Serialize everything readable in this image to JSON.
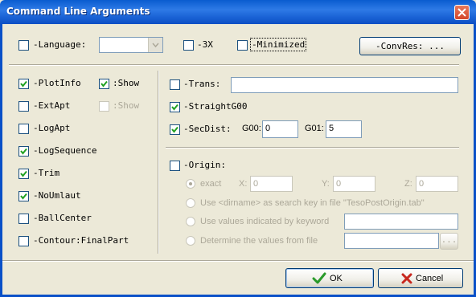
{
  "window": {
    "title": "Command Line Arguments"
  },
  "top": {
    "language_label": "-Language:",
    "language_value": "",
    "x3_label": "-3X",
    "minimized_label": "-Minimized",
    "convres_label": "-ConvRes: ..."
  },
  "left": {
    "plotinfo": "-PlotInfo",
    "plotinfo_show": ":Show",
    "extapt": "-ExtApt",
    "extapt_show": ":Show",
    "logapt": "-LogApt",
    "logsequence": "-LogSequence",
    "trim": "-Trim",
    "noumlaut": "-NoUmlaut",
    "ballcenter": "-BallCenter",
    "contour": "-Contour:FinalPart"
  },
  "right": {
    "trans_label": "-Trans:",
    "trans_value": "",
    "straight_label": "-StraightG00",
    "secdist_label": "-SecDist:",
    "g00_label": "G00:",
    "g00_value": "0",
    "g01_label": "G01:",
    "g01_value": "5",
    "origin_label": "-Origin:",
    "exact_label": "exact",
    "x_label": "X:",
    "x_value": "0",
    "y_label": "Y:",
    "y_value": "0",
    "z_label": "Z:",
    "z_value": "0",
    "dirname_label": "Use <dirname> as search key in file \"TesoPostOrigin.tab\"",
    "keyword_label": "Use values indicated by keyword",
    "keyword_value": "",
    "file_label": "Determine the values from file",
    "file_value": "",
    "browse_label": "..."
  },
  "buttons": {
    "ok": "OK",
    "cancel": "Cancel"
  },
  "colors": {
    "title_bar": "#0a5ccf",
    "dialog_bg": "#ece9d8",
    "ok_check": "#2a9a2a",
    "cancel_x": "#c8281e"
  }
}
